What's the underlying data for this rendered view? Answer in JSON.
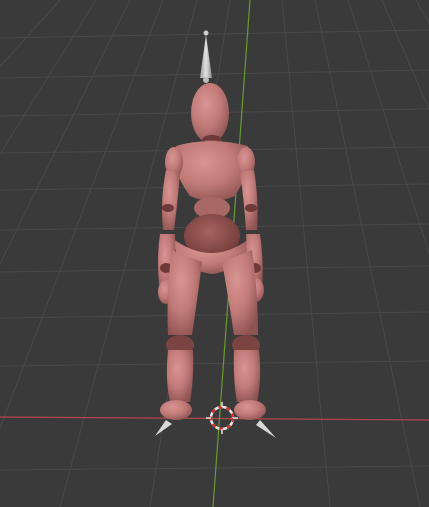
{
  "viewport": {
    "background": "#3a3a3a",
    "grid_color": "#4a4a4a",
    "x_axis_color": "#b5454a",
    "y_axis_color": "#6a9a32"
  },
  "model": {
    "skin_color": "#c07a78",
    "skin_shadow": "#8a4f4d",
    "joint_color": "#6e3a38",
    "bone_color": "#c8c8c8"
  },
  "cursor_3d": {
    "outer_color": "#e8e8e8",
    "dash_color": "#d43030"
  }
}
